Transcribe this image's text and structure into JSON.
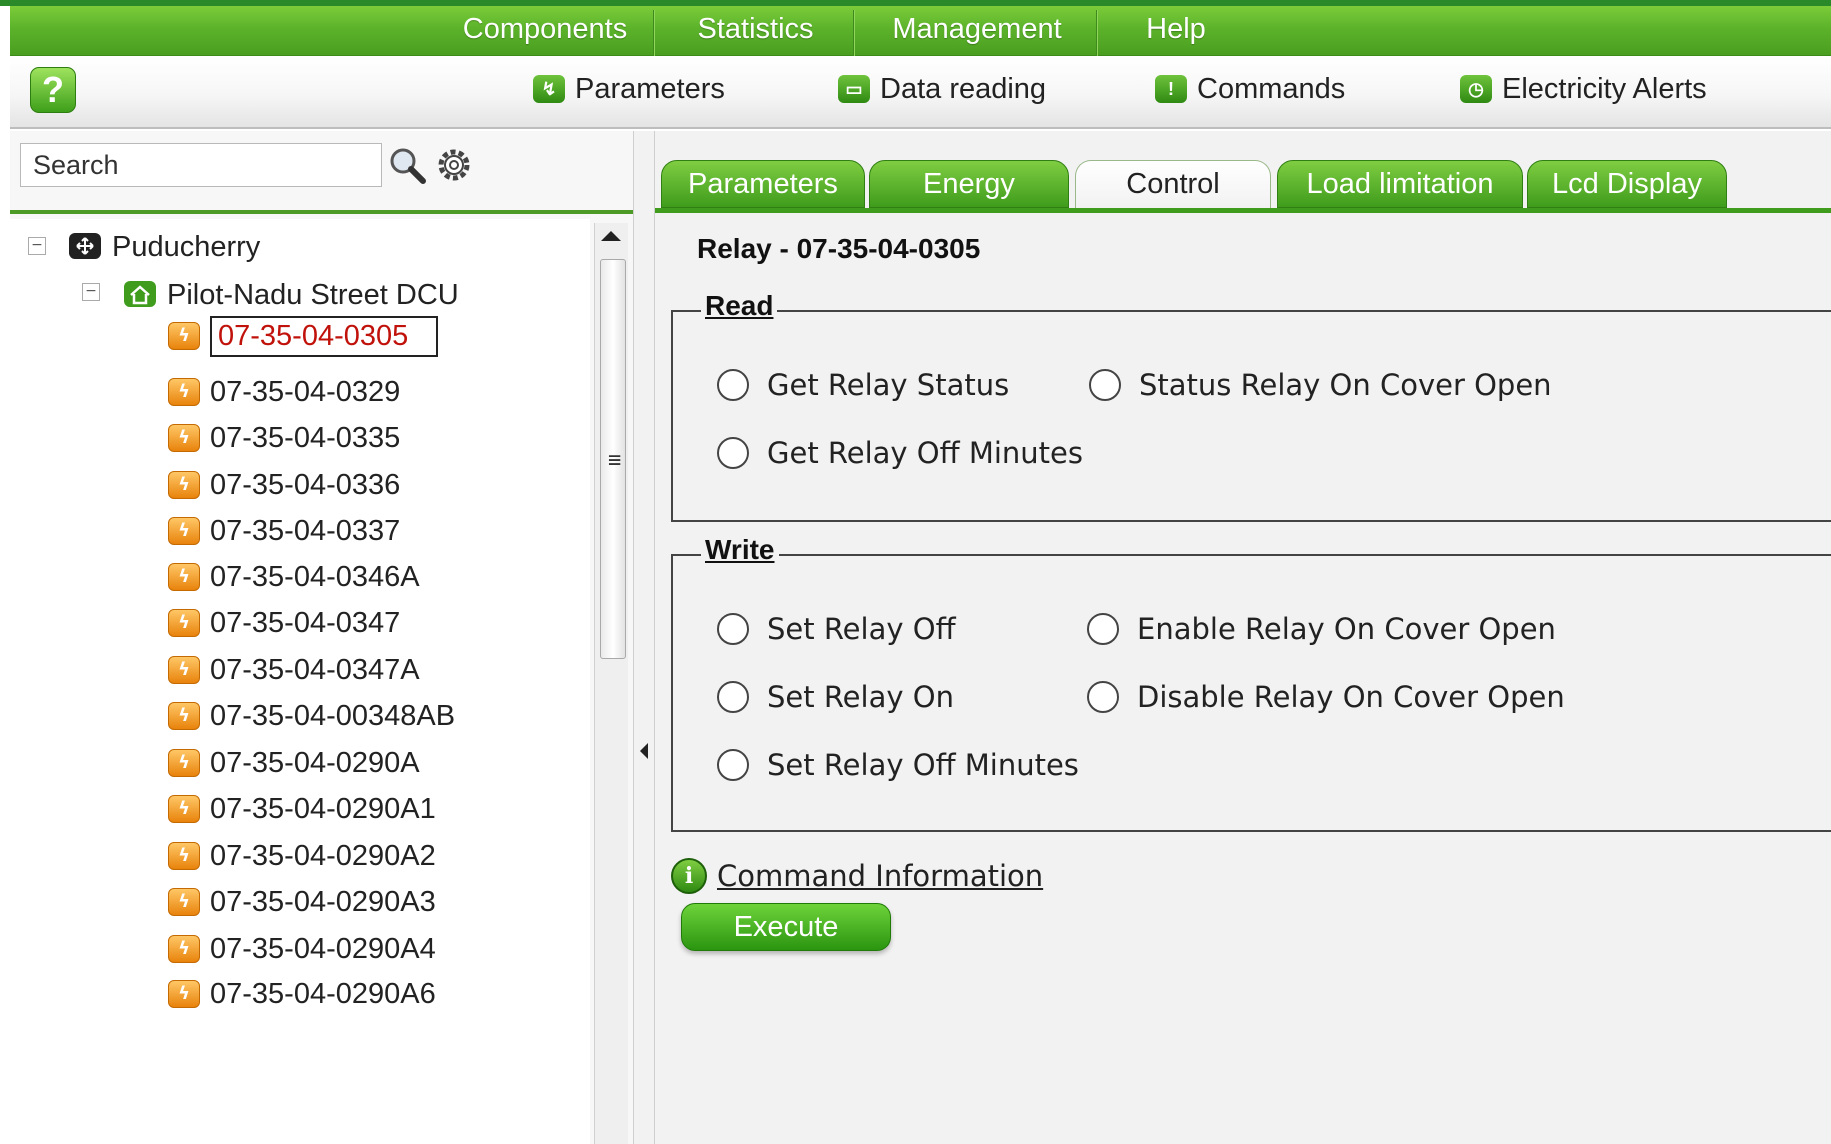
{
  "menu": {
    "items": [
      "Components",
      "Statistics",
      "Management",
      "Help"
    ]
  },
  "toolbar": {
    "help_icon": "question-icon",
    "items": [
      {
        "label": "Parameters",
        "icon": "parameters-icon"
      },
      {
        "label": "Data reading",
        "icon": "data-reading-icon"
      },
      {
        "label": "Commands",
        "icon": "commands-icon"
      },
      {
        "label": "Electricity Alerts",
        "icon": "alerts-icon"
      }
    ]
  },
  "search": {
    "placeholder": "Search",
    "value": "Search"
  },
  "tree": {
    "root": "Puducherry",
    "group": "Pilot-Nadu Street DCU",
    "selected": "07-35-04-0305",
    "meters": [
      "07-35-04-0305",
      "07-35-04-0329",
      "07-35-04-0335",
      "07-35-04-0336",
      "07-35-04-0337",
      "07-35-04-0346A",
      "07-35-04-0347",
      "07-35-04-0347A",
      "07-35-04-00348AB",
      "07-35-04-0290A",
      "07-35-04-0290A1",
      "07-35-04-0290A2",
      "07-35-04-0290A3",
      "07-35-04-0290A4",
      "07-35-04-0290A6"
    ]
  },
  "tabs": [
    "Parameters",
    "Energy",
    "Control",
    "Load limitation",
    "Lcd Display"
  ],
  "active_tab": "Control",
  "content": {
    "relay_title": "Relay - 07-35-04-0305",
    "read": {
      "legend": "Read",
      "options": [
        "Get Relay Status",
        "Status Relay On Cover Open",
        "Get Relay Off Minutes"
      ]
    },
    "write": {
      "legend": "Write",
      "options": [
        "Set Relay Off",
        "Enable Relay On Cover Open",
        "Set Relay On",
        "Disable Relay On Cover Open",
        "Set Relay Off Minutes"
      ]
    },
    "command_info": "Command Information",
    "execute": "Execute"
  },
  "colors": {
    "brand_green": "#4a9e20",
    "selected_text": "#c0110a",
    "meter_orange": "#e8830c"
  }
}
